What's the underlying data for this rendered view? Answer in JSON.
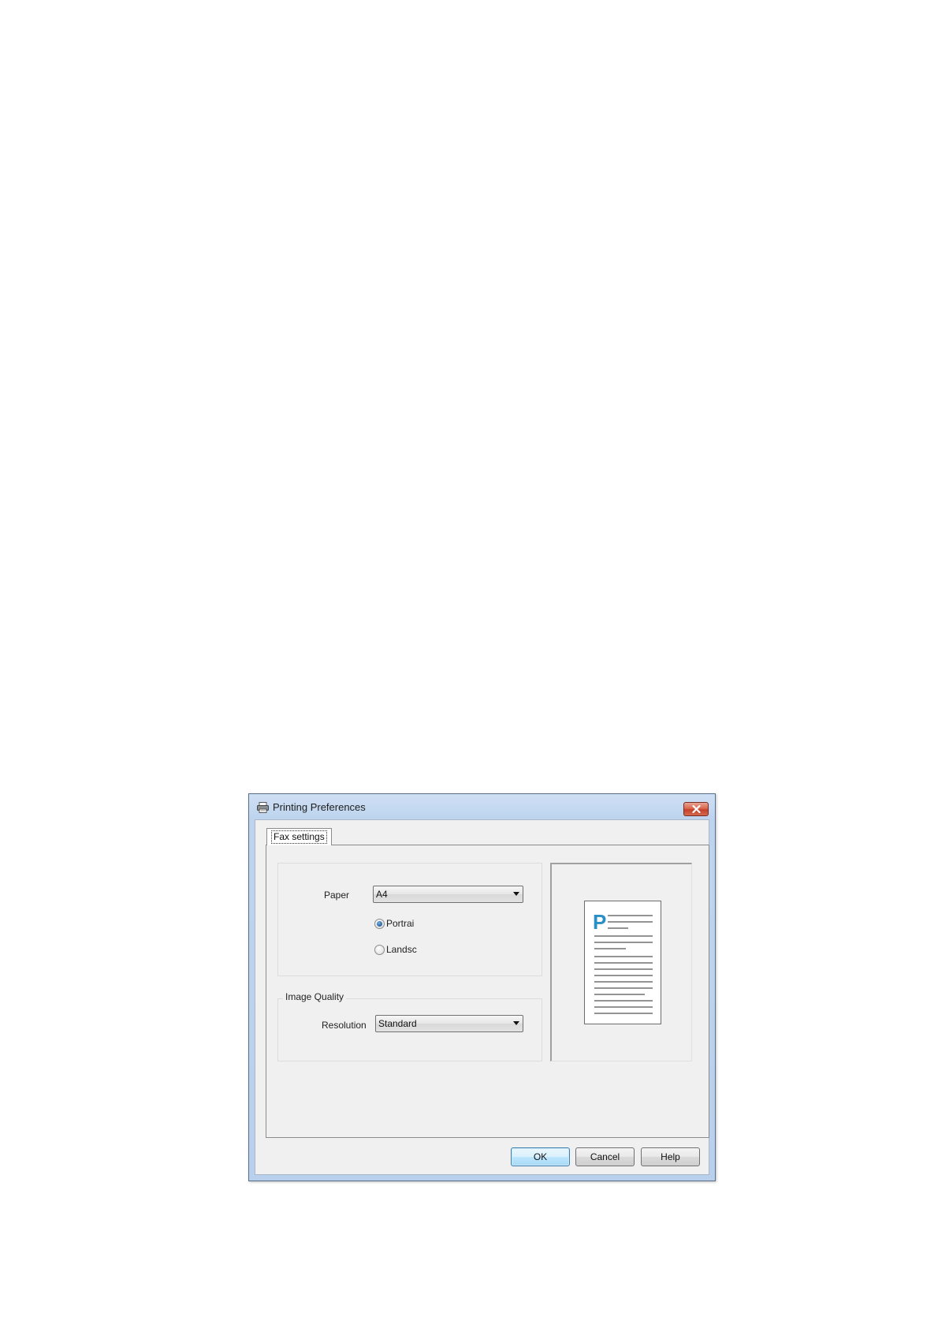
{
  "window": {
    "title": "Printing Preferences"
  },
  "tabs": [
    {
      "label": "Fax settings",
      "selected": true
    }
  ],
  "paper": {
    "label": "Paper",
    "value": "A4"
  },
  "orientation": {
    "options": [
      {
        "label": "Portrai",
        "checked": true
      },
      {
        "label": "Landsc",
        "checked": false
      }
    ]
  },
  "image_quality": {
    "legend": "Image Quality",
    "resolution_label": "Resolution",
    "resolution_value": "Standard"
  },
  "preview": {
    "letter": "P",
    "accent_color": "#2a8fc4"
  },
  "buttons": {
    "ok": "OK",
    "cancel": "Cancel",
    "help": "Help"
  },
  "icons": {
    "title": "printer-icon",
    "close": "close-icon",
    "dropdown": "chevron-down-icon"
  }
}
